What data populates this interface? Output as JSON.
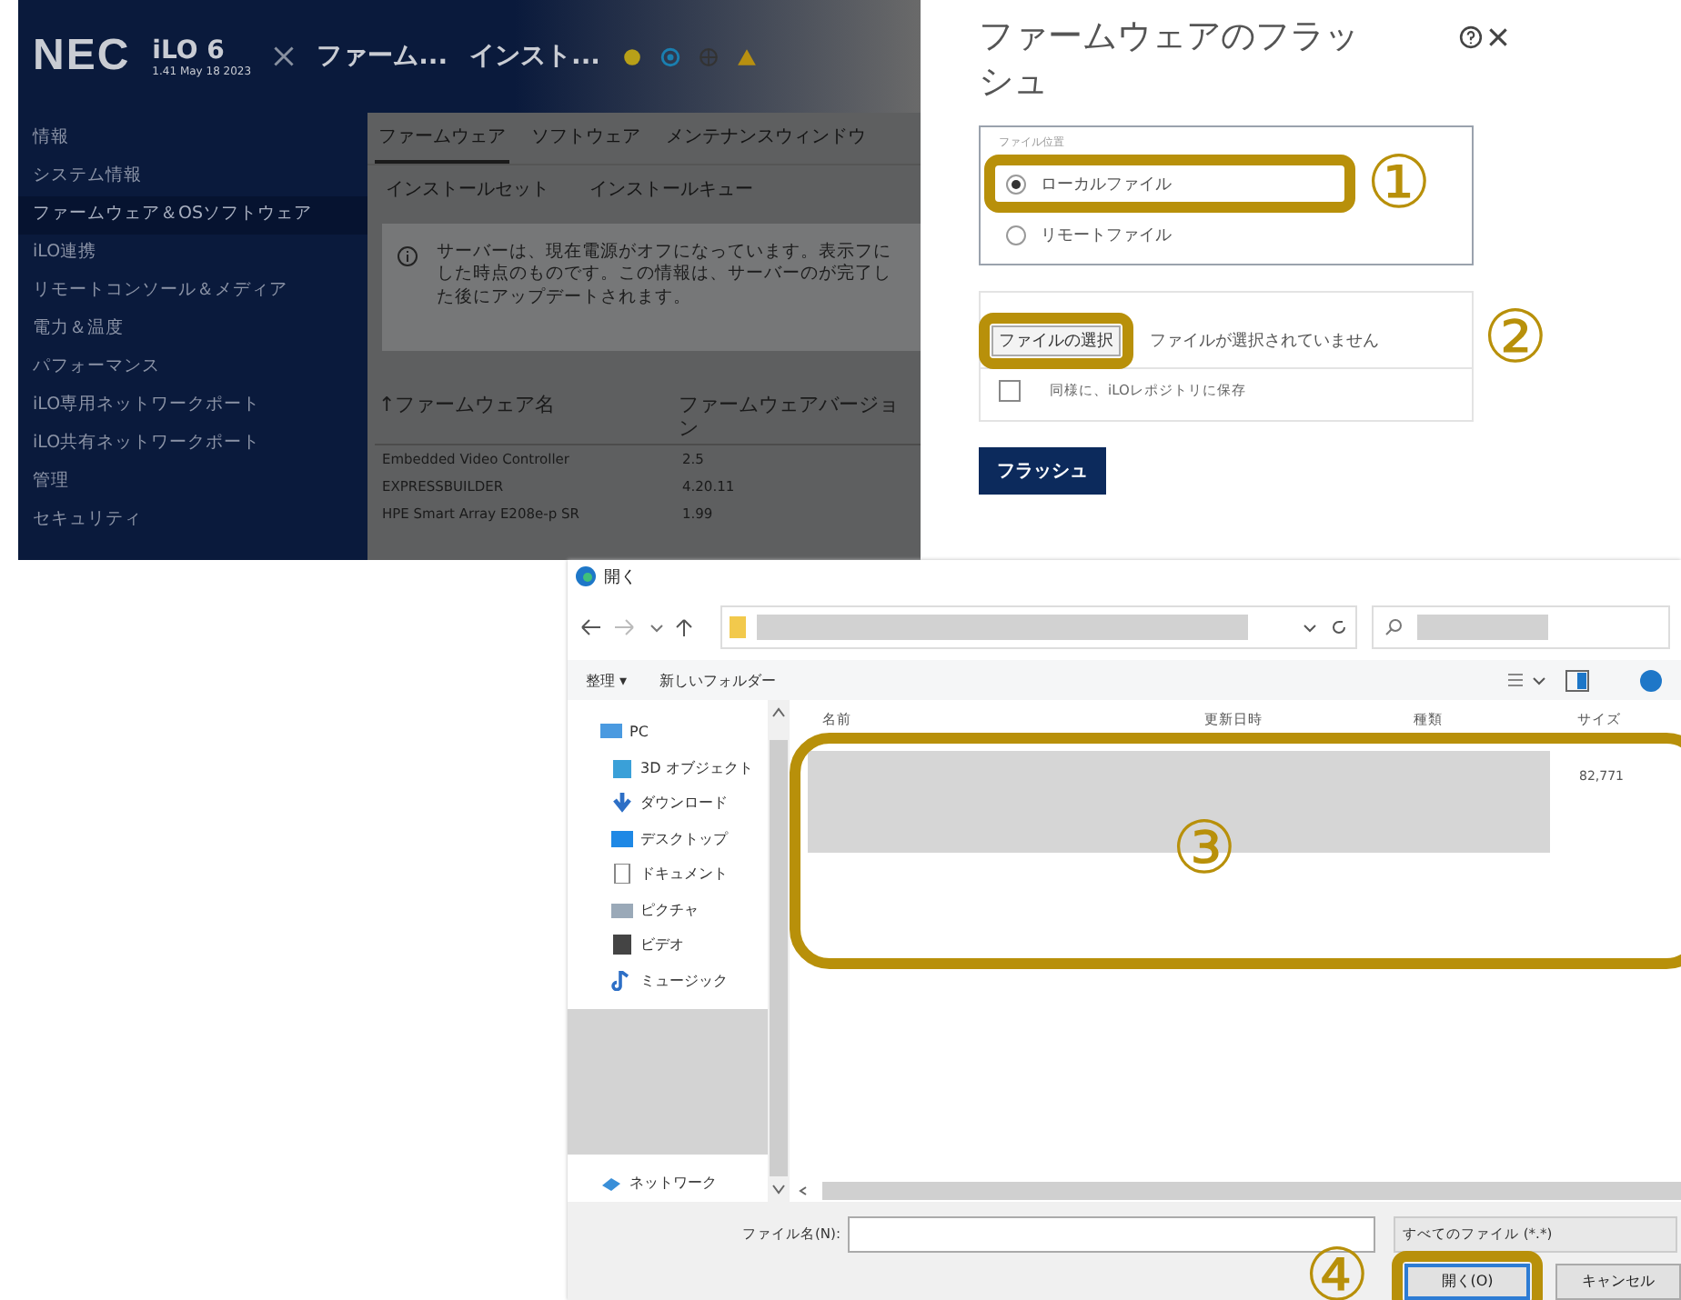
{
  "ilo": {
    "logo": "NEC",
    "product": "iLO 6",
    "version": "1.41 May 18 2023",
    "breadcrumbs": [
      "ファーム...",
      "インスト..."
    ],
    "nav": [
      {
        "label": "情報",
        "selected": false
      },
      {
        "label": "システム情報",
        "selected": false
      },
      {
        "label": "ファームウェア＆OSソフトウェア",
        "selected": true
      },
      {
        "label": "iLO連携",
        "selected": false
      },
      {
        "label": "リモートコンソール＆メディア",
        "selected": false
      },
      {
        "label": "電力＆温度",
        "selected": false
      },
      {
        "label": "パフォーマンス",
        "selected": false
      },
      {
        "label": "iLO専用ネットワークポート",
        "selected": false
      },
      {
        "label": "iLO共有ネットワークポート",
        "selected": false
      },
      {
        "label": "管理",
        "selected": false
      },
      {
        "label": "セキュリティ",
        "selected": false
      }
    ],
    "tabs": [
      {
        "label": "ファームウェア",
        "selected": true
      },
      {
        "label": "ソフトウェア",
        "selected": false
      },
      {
        "label": "メンテナンスウィンドウ",
        "selected": false
      }
    ],
    "subtabs": [
      {
        "label": "インストールセット",
        "selected": false
      },
      {
        "label": "インストールキュー",
        "selected": false
      }
    ],
    "notice": "サーバーは、現在電源がオフになっています。表示フにした時点のものです。この情報は、サーバーのが完了した後にアップデートされます。",
    "table": {
      "columns": [
        "↑ファームウェア名",
        "ファームウェアバージョン"
      ],
      "rows": [
        [
          "Embedded Video Controller",
          "2.5"
        ],
        [
          "EXPRESSBUILDER",
          "4.20.11"
        ],
        [
          "HPE Smart Array E208e-p SR",
          "1.99"
        ]
      ]
    }
  },
  "flash": {
    "title": "ファームウェアのフラッシュ",
    "source_label": "ファイル位置",
    "radios": [
      {
        "label": "ローカルファイル",
        "selected": true
      },
      {
        "label": "リモートファイル",
        "selected": false
      }
    ],
    "choose_button": "ファイルの選択",
    "file_status": "ファイルが選択されていません",
    "save_checkbox": {
      "label": "同様に、iLOレポジトリに保存",
      "checked": false
    },
    "flash_button": "フラッシュ"
  },
  "open_dialog": {
    "title": "開く",
    "toolbar": [
      "整理 ▾",
      "新しいフォルダー"
    ],
    "nav": [
      "PC",
      "3D オブジェクト",
      "ダウンロード",
      "デスクトップ",
      "ドキュメント",
      "ピクチャ",
      "ビデオ",
      "ミュージック",
      "ネットワーク"
    ],
    "columns": [
      "名前",
      "更新日時",
      "種類",
      "サイズ"
    ],
    "size_value": "82,771",
    "filename_label": "ファイル名(N):",
    "filetype": "すべてのファイル (*.*)",
    "buttons": [
      {
        "label": "開く(O)",
        "kind": "primary"
      },
      {
        "label": "キャンセル",
        "kind": "normal"
      }
    ]
  },
  "annotations": [
    {
      "label": "①"
    },
    {
      "label": "②"
    },
    {
      "label": "③"
    },
    {
      "label": "④"
    }
  ]
}
